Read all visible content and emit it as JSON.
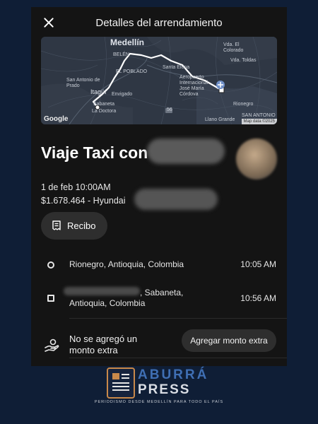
{
  "header": {
    "title": "Detalles del arrendamiento"
  },
  "map": {
    "labels": {
      "medellin": "Medellín",
      "belen": "BELÉN",
      "el_poblado": "EL POBLADO",
      "santa_elena": "Santa Elena",
      "san_antonio_prado": "San Antonio de Prado",
      "itagui": "Itagüí",
      "envigado": "Envigado",
      "sabaneta": "Sabaneta",
      "la_doctora": "La Doctora",
      "aeropuerto": "Aeropuerto Internacional José María Córdova",
      "el_colorado": "Vda. El Colorado",
      "toldas": "Vda. Toldas",
      "rionegro": "Rionegro",
      "san_antonio": "SAN ANTONIO",
      "llano_grande": "Llano Grande",
      "road_56": "56"
    },
    "attribution": "Google",
    "map_data": "Map data ©2025"
  },
  "trip": {
    "title": "Viaje Taxi con",
    "date": "1 de feb 10:00AM",
    "fare_prefix": "$1.678.464 - Hyundai"
  },
  "receipt": {
    "label": "Recibo"
  },
  "stops": [
    {
      "address": "Rionegro, Antioquia, Colombia",
      "time": "10:05 AM"
    },
    {
      "address_line1": ", Sabaneta,",
      "address_line2": "Antioquia, Colombia",
      "time": "10:56 AM"
    }
  ],
  "extra": {
    "line1": "No se agregó un",
    "line2": "monto extra",
    "button": "Agregar monto extra"
  },
  "brand": {
    "name1": "ABURRÁ",
    "name2": "PRESS",
    "tagline": "PERIODISMO DESDE MEDELLÍN PARA TODO EL PAÍS"
  }
}
